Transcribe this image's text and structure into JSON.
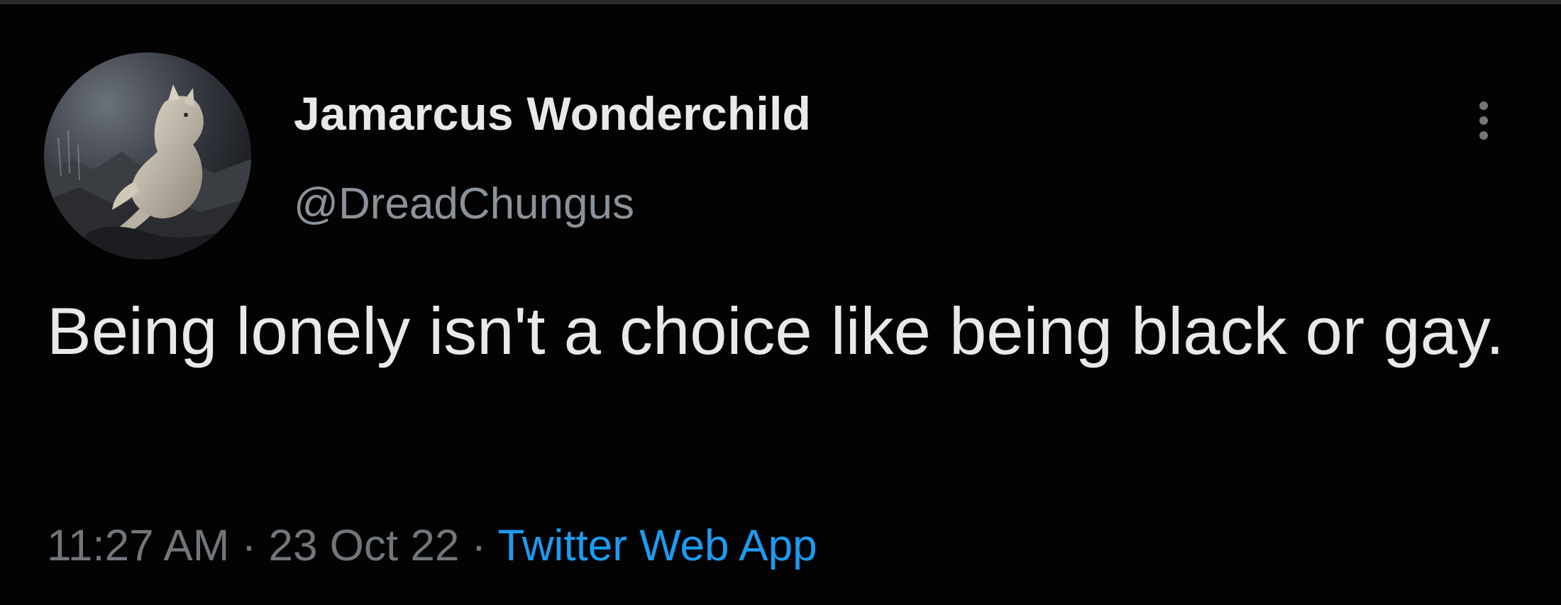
{
  "user": {
    "display_name": "Jamarcus Wonderchild",
    "handle": "@DreadChungus",
    "avatar_icon": "werewolf-avatar"
  },
  "tweet": {
    "text": "Being lonely isn't a choice like being black or gay.",
    "time": "11:27 AM",
    "separator": "·",
    "date": "23 Oct 22",
    "source": "Twitter Web App"
  },
  "menu": {
    "icon": "more-vertical-icon"
  },
  "colors": {
    "background": "#030303",
    "primary_text": "#e7e9ea",
    "secondary_text": "#71767b",
    "link": "#1d9bf0"
  }
}
